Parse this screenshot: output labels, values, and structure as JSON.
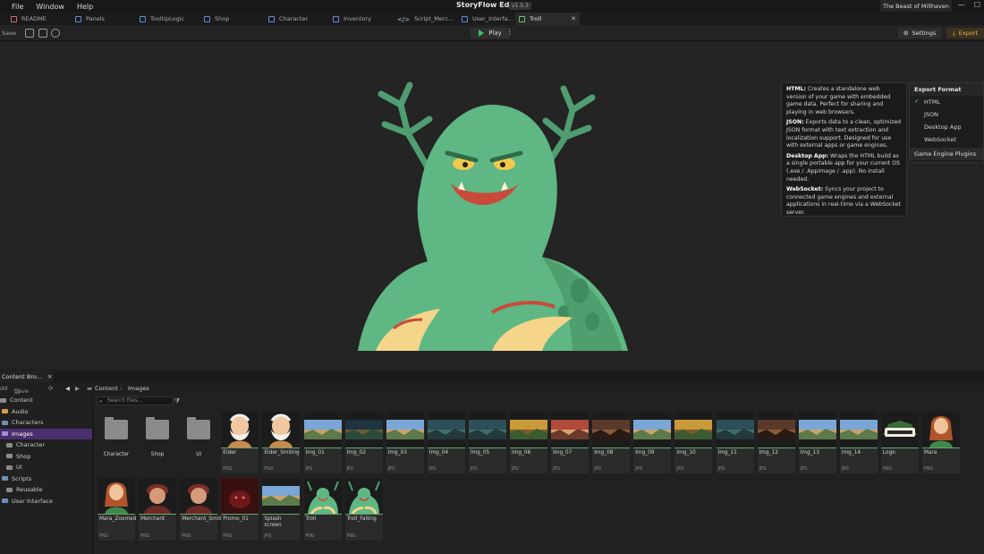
{
  "menu": [
    "File",
    "Window",
    "Help"
  ],
  "app_title": "StoryFlow Editor",
  "version": "v1.5.3",
  "project_name": "The Beast of Millhaven",
  "tabs": [
    {
      "label": "README"
    },
    {
      "label": "Panels"
    },
    {
      "label": "TooltipLogic"
    },
    {
      "label": "Shop"
    },
    {
      "label": "Character"
    },
    {
      "label": "Inventory"
    },
    {
      "label": "Script_Merc..."
    },
    {
      "label": "User_Interfa..."
    },
    {
      "label": "Troll",
      "active": true
    }
  ],
  "toolbar": {
    "save": "Save",
    "play": "Play",
    "settings": "Settings",
    "export": "Export"
  },
  "tooltip": [
    {
      "title": "HTML:",
      "text": "Creates a standalone web version of your game with embedded game data. Perfect for sharing and playing in web browsers."
    },
    {
      "title": "JSON:",
      "text": "Exports data to a clean, optimized JSON format with text extraction and localization support. Designed for use with external apps or game engines."
    },
    {
      "title": "Desktop App:",
      "text": "Wraps the HTML build as a single portable app for your current OS (.exe / .AppImage / .app). No install needed."
    },
    {
      "title": "WebSocket:",
      "text": "Syncs your project to connected game engines and external applications in real-time via a WebSocket server."
    }
  ],
  "export_menu": {
    "header": "Export Format",
    "options": [
      "HTML",
      "JSON",
      "Desktop App",
      "WebSocket"
    ],
    "selected": "HTML",
    "footer": "Game Engine Plugins"
  },
  "content_browser": {
    "tab_label": "Content Bro...",
    "add": "dd",
    "save_all": "Save All",
    "path": [
      "Content",
      "Images"
    ],
    "search_placeholder": "Search files...",
    "tree": [
      {
        "label": "Content",
        "level": 0
      },
      {
        "label": "Audio",
        "level": 1
      },
      {
        "label": "Characters",
        "level": 1
      },
      {
        "label": "Images",
        "level": 1,
        "selected": true
      },
      {
        "label": "Character",
        "level": 2
      },
      {
        "label": "Shop",
        "level": 2
      },
      {
        "label": "UI",
        "level": 2
      },
      {
        "label": "Scripts",
        "level": 1
      },
      {
        "label": "Reusable",
        "level": 2
      },
      {
        "label": "User Interface",
        "level": 1
      }
    ],
    "folders": [
      "Character",
      "Shop",
      "UI"
    ],
    "files": [
      {
        "name": "Elder",
        "ext": "PNG",
        "kind": "elder"
      },
      {
        "name": "Elder_Smiling",
        "ext": "PNG",
        "kind": "elder"
      },
      {
        "name": "Img_01",
        "ext": "JPG",
        "kind": "scene-sky"
      },
      {
        "name": "Img_02",
        "ext": "JPG",
        "kind": "scene-dark"
      },
      {
        "name": "Img_03",
        "ext": "JPG",
        "kind": "scene-sky"
      },
      {
        "name": "Img_04",
        "ext": "JPG",
        "kind": "scene-teal"
      },
      {
        "name": "Img_05",
        "ext": "JPG",
        "kind": "scene-teal"
      },
      {
        "name": "Img_06",
        "ext": "JPG",
        "kind": "scene-warm"
      },
      {
        "name": "Img_07",
        "ext": "JPG",
        "kind": "scene-red"
      },
      {
        "name": "Img_08",
        "ext": "JPG",
        "kind": "scene-brown"
      },
      {
        "name": "Img_09",
        "ext": "JPG",
        "kind": "scene-sky"
      },
      {
        "name": "Img_10",
        "ext": "JPG",
        "kind": "scene-warm"
      },
      {
        "name": "Img_11",
        "ext": "JPG",
        "kind": "scene-teal"
      },
      {
        "name": "Img_12",
        "ext": "JPG",
        "kind": "scene-brown"
      },
      {
        "name": "Img_13",
        "ext": "JPG",
        "kind": "scene-sky"
      },
      {
        "name": "Img_14",
        "ext": "JPG",
        "kind": "scene-sky"
      },
      {
        "name": "Logo",
        "ext": "PNG",
        "kind": "logo"
      },
      {
        "name": "Mara",
        "ext": "PNG",
        "kind": "mara"
      },
      {
        "name": "Mara_Zoomed",
        "ext": "PNG",
        "kind": "mara"
      },
      {
        "name": "Merchant",
        "ext": "PNG",
        "kind": "merchant"
      },
      {
        "name": "Merchant_Smiling",
        "ext": "PNG",
        "kind": "merchant"
      },
      {
        "name": "Promo_01",
        "ext": "PNG",
        "kind": "promo"
      },
      {
        "name": "Splash screen",
        "ext": "JPG",
        "kind": "scene-sky"
      },
      {
        "name": "Troll",
        "ext": "PNG",
        "kind": "troll"
      },
      {
        "name": "Troll_Falling",
        "ext": "PNG",
        "kind": "troll"
      }
    ]
  },
  "colors": {
    "accent": "#4a2f6e",
    "play": "#3fbf5a",
    "export": "#f0b64a",
    "troll": "#5fb783"
  }
}
